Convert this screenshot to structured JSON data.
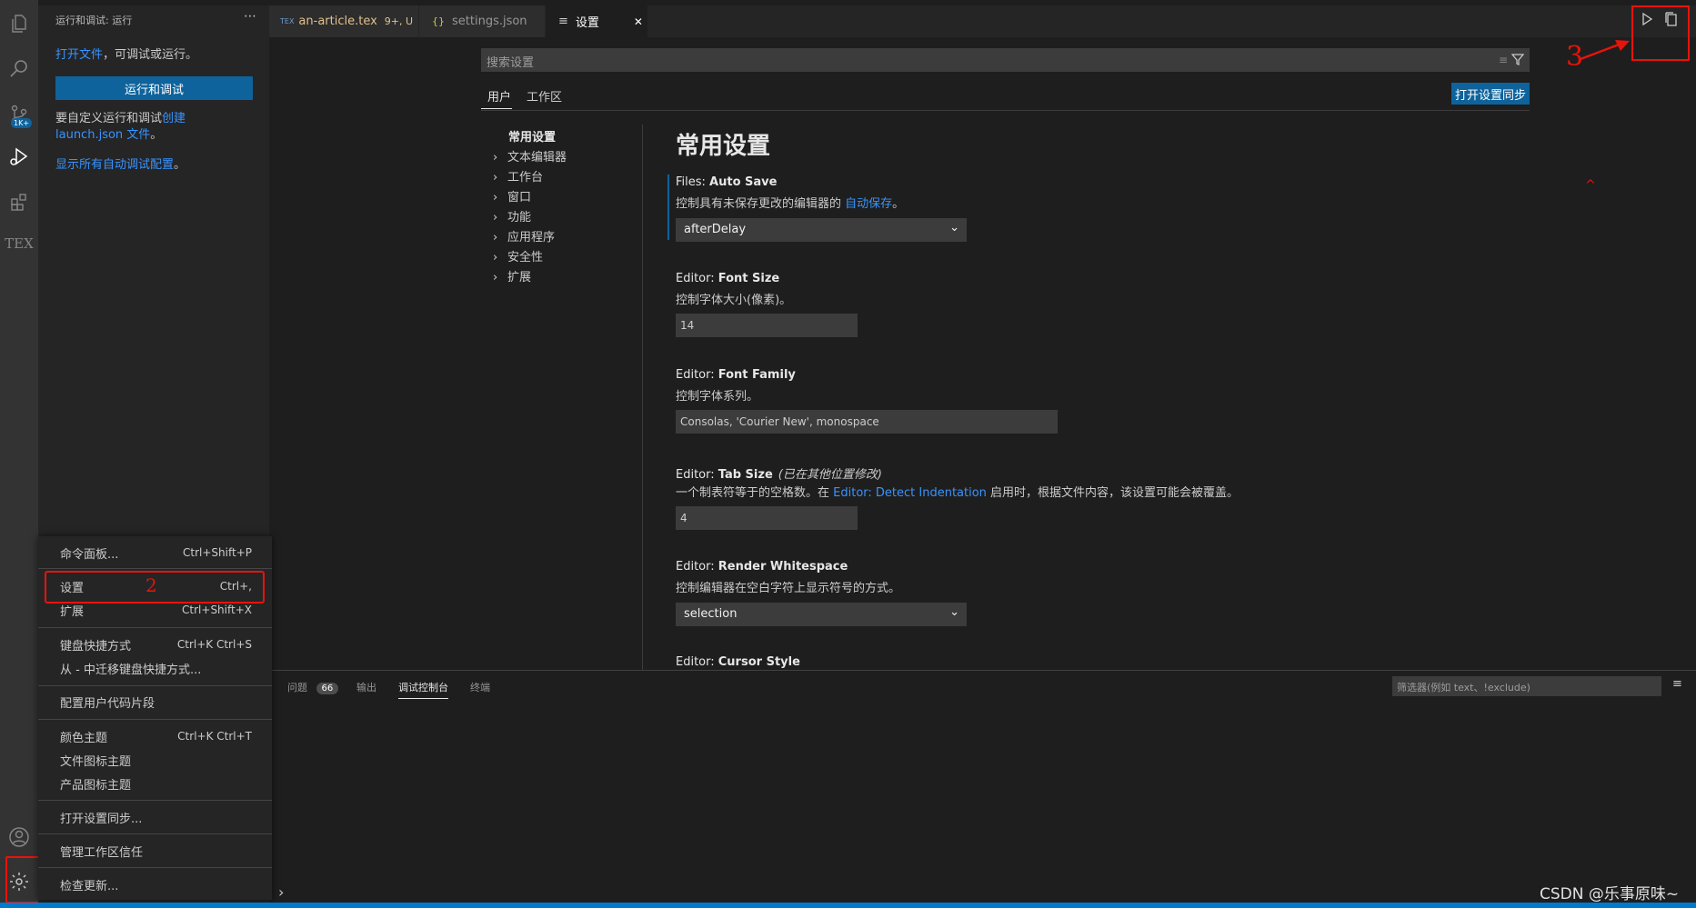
{
  "sidebar": {
    "title": "运行和调试: 运行",
    "more_icon": "⋯",
    "open_file_link": "打开文件",
    "open_file_rest": "，可调试或运行。",
    "run_button": "运行和调试",
    "customize_pre": "要自定义运行和调试",
    "customize_link": "创建 launch.json 文件",
    "customize_post": "。",
    "show_all_link": "显示所有自动调试配置",
    "show_all_post": "。"
  },
  "activity": {
    "scm_badge": "1K+",
    "tex_label": "TEX"
  },
  "tabs": [
    {
      "icon": "TEX",
      "label": "an-article.tex",
      "suffix": "9+, U"
    },
    {
      "icon": "{}",
      "label": "settings.json"
    },
    {
      "icon": "≡",
      "label": "设置",
      "close": "✕"
    }
  ],
  "settings": {
    "search_placeholder": "搜索设置",
    "scope_user": "用户",
    "scope_workspace": "工作区",
    "sync_button": "打开设置同步",
    "toc": [
      "常用设置",
      "文本编辑器",
      "工作台",
      "窗口",
      "功能",
      "应用程序",
      "安全性",
      "扩展"
    ],
    "heading": "常用设置",
    "items": [
      {
        "prefix": "Files: ",
        "name": "Auto Save",
        "desc_pre": "控制具有未保存更改的编辑器的 ",
        "desc_link": "自动保存",
        "desc_post": "。",
        "value": "afterDelay"
      },
      {
        "prefix": "Editor: ",
        "name": "Font Size",
        "desc": "控制字体大小(像素)。",
        "value": "14"
      },
      {
        "prefix": "Editor: ",
        "name": "Font Family",
        "desc": "控制字体系列。",
        "value": "Consolas, 'Courier New', monospace"
      },
      {
        "prefix": "Editor: ",
        "name": "Tab Size",
        "modified": "(已在其他位置修改)",
        "desc_pre": "一个制表符等于的空格数。在 ",
        "desc_link": "Editor: Detect Indentation",
        "desc_post": " 启用时，根据文件内容，该设置可能会被覆盖。",
        "value": "4"
      },
      {
        "prefix": "Editor: ",
        "name": "Render Whitespace",
        "desc": "控制编辑器在空白字符上显示符号的方式。",
        "value": "selection"
      },
      {
        "prefix": "Editor: ",
        "name": "Cursor Style"
      }
    ]
  },
  "panel": {
    "tabs": [
      "问题",
      "输出",
      "调试控制台",
      "终端"
    ],
    "problems_count": "66",
    "filter_placeholder": "筛选器(例如 text、!exclude)",
    "prompt": "›"
  },
  "menu": [
    {
      "label": "命令面板...",
      "kb": "Ctrl+Shift+P"
    },
    {
      "label": "设置",
      "kb": "Ctrl+,"
    },
    {
      "label": "扩展",
      "kb": "Ctrl+Shift+X"
    },
    {
      "label": "键盘快捷方式",
      "kb": "Ctrl+K Ctrl+S"
    },
    {
      "label": "从 - 中迁移键盘快捷方式...",
      "kb": ""
    },
    {
      "label": "配置用户代码片段",
      "kb": ""
    },
    {
      "label": "颜色主题",
      "kb": "Ctrl+K Ctrl+T"
    },
    {
      "label": "文件图标主题",
      "kb": ""
    },
    {
      "label": "产品图标主题",
      "kb": ""
    },
    {
      "label": "打开设置同步...",
      "kb": ""
    },
    {
      "label": "管理工作区信任",
      "kb": ""
    },
    {
      "label": "检查更新...",
      "kb": ""
    }
  ],
  "annotations": {
    "two": "2",
    "three": "3"
  },
  "watermark": "CSDN @乐事原味~",
  "colors": {
    "accent": "#0e639c",
    "link": "#3794ff",
    "annotation": "#e8130b",
    "status": "#007acc"
  }
}
